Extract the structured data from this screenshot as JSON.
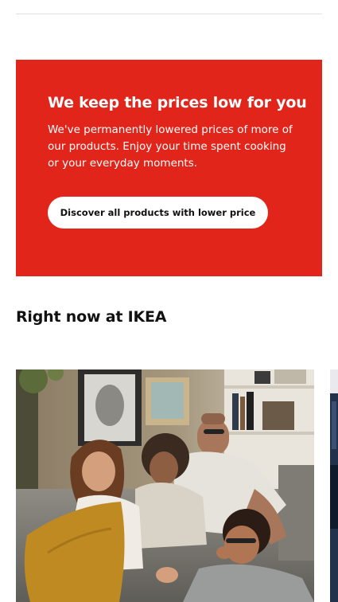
{
  "promo": {
    "title": "We keep the prices low for you",
    "body": "We've permanently lowered prices of more of our products. Enjoy your time spent cooking or your everyday moments.",
    "button_label": "Discover all products with lower price",
    "background_color": "#e1251b"
  },
  "section": {
    "title": "Right now at IKEA"
  },
  "cards": [
    {
      "image_description_icon": "family-on-sofa-photo"
    },
    {
      "image_description_icon": "next-card-photo"
    }
  ]
}
